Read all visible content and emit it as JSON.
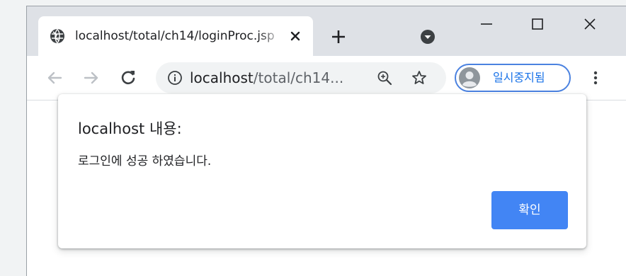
{
  "browser": {
    "tab": {
      "title": "localhost/total/ch14/loginProc.jsp",
      "favicon": "globe-icon",
      "close_icon": "close-icon"
    },
    "new_tab_icon": "plus-icon",
    "tab_search_icon": "chevron-down-circle-icon",
    "window_controls": [
      "minimize-icon",
      "maximize-icon",
      "close-icon"
    ],
    "toolbar": {
      "back_icon": "arrow-left-icon",
      "forward_icon": "arrow-right-icon",
      "reload_icon": "reload-icon",
      "omnibox": {
        "site_info_icon": "info-icon",
        "url_host": "localhost",
        "url_path": "/total/ch14...",
        "zoom_icon": "zoom-in-icon",
        "bookmark_icon": "star-icon"
      },
      "profile": {
        "label": "일시중지됨",
        "avatar_icon": "avatar-icon"
      },
      "menu_icon": "kebab-menu-icon"
    }
  },
  "dialog": {
    "title": "localhost 내용:",
    "message": "로그인에 성공 하였습니다.",
    "ok_label": "확인"
  },
  "colors": {
    "tabstrip_bg": "#dee1e6",
    "omnibox_bg": "#f1f3f4",
    "accent": "#4285f4",
    "profile_border": "#4b82e0",
    "profile_text": "#1a73e8"
  }
}
